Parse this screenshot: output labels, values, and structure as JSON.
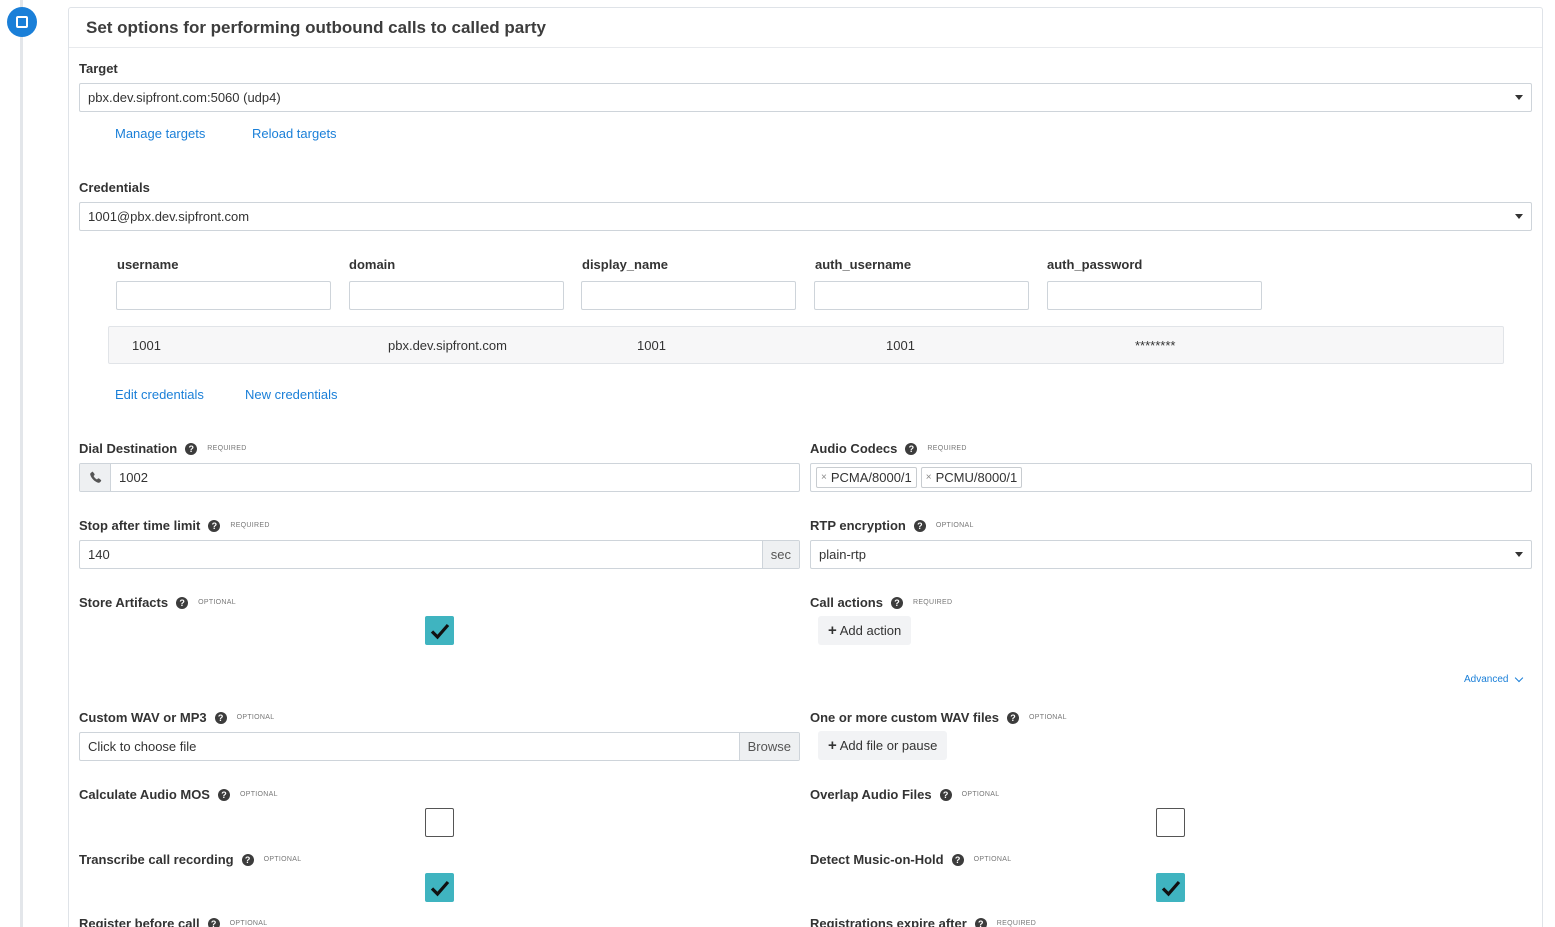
{
  "header": {
    "title": "Set options for performing outbound calls to called party"
  },
  "target": {
    "label": "Target",
    "value": "pbx.dev.sipfront.com:5060 (udp4)",
    "links": {
      "manage": "Manage targets",
      "reload": "Reload targets"
    }
  },
  "credentials": {
    "label": "Credentials",
    "value": "1001@pbx.dev.sipfront.com",
    "columns": [
      "username",
      "domain",
      "display_name",
      "auth_username",
      "auth_password"
    ],
    "rows": [
      {
        "username": "1001",
        "domain": "pbx.dev.sipfront.com",
        "display_name": "1001",
        "auth_username": "1001",
        "auth_password": "********"
      }
    ],
    "links": {
      "edit": "Edit credentials",
      "new": "New credentials"
    }
  },
  "dial_destination": {
    "label": "Dial Destination",
    "tag": "REQUIRED",
    "value": "1002"
  },
  "audio_codecs": {
    "label": "Audio Codecs",
    "tag": "REQUIRED",
    "chips": [
      "PCMA/8000/1",
      "PCMU/8000/1"
    ]
  },
  "time_limit": {
    "label": "Stop after time limit",
    "tag": "REQUIRED",
    "value": "140",
    "unit": "sec"
  },
  "rtp_encryption": {
    "label": "RTP encryption",
    "tag": "OPTIONAL",
    "value": "plain-rtp"
  },
  "store_artifacts": {
    "label": "Store Artifacts",
    "tag": "OPTIONAL",
    "checked": true
  },
  "call_actions": {
    "label": "Call actions",
    "tag": "REQUIRED",
    "button": "Add action"
  },
  "advanced": {
    "label": "Advanced"
  },
  "custom_wav": {
    "label": "Custom WAV or MP3",
    "tag": "OPTIONAL",
    "placeholder": "Click to choose file",
    "browse": "Browse"
  },
  "custom_wav_files": {
    "label": "One or more custom WAV files",
    "tag": "OPTIONAL",
    "button": "Add file or pause"
  },
  "calc_mos": {
    "label": "Calculate Audio MOS",
    "tag": "OPTIONAL",
    "checked": false
  },
  "overlap_audio": {
    "label": "Overlap Audio Files",
    "tag": "OPTIONAL",
    "checked": false
  },
  "transcribe": {
    "label": "Transcribe call recording",
    "tag": "OPTIONAL",
    "checked": true
  },
  "detect_moh": {
    "label": "Detect Music-on-Hold",
    "tag": "OPTIONAL",
    "checked": true
  },
  "register_before": {
    "label": "Register before call",
    "tag": "OPTIONAL"
  },
  "reg_expire": {
    "label": "Registrations expire after",
    "tag": "REQUIRED"
  },
  "colors": {
    "accent": "#1a7fd8",
    "checkbox_on": "#3fb4c0"
  }
}
